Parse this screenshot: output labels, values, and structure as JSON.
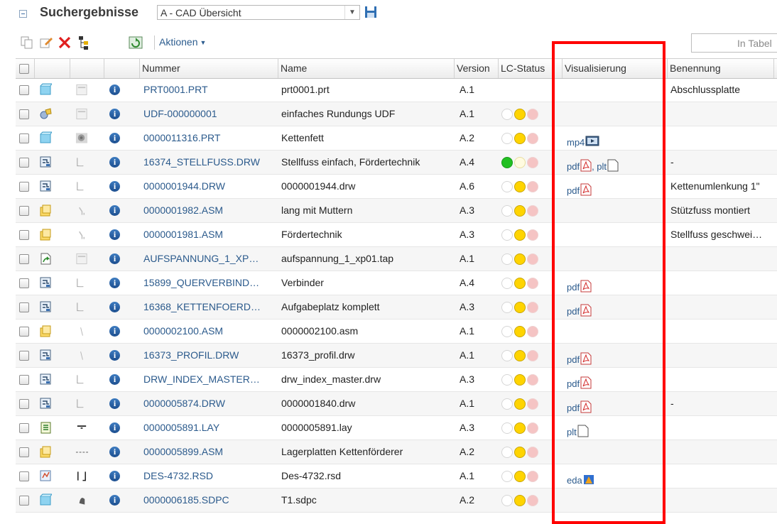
{
  "header": {
    "title": "Suchergebnisse",
    "view_select_value": "A - CAD Übersicht"
  },
  "toolbar": {
    "actions_label": "Aktionen",
    "table_search_placeholder": "In Tabel"
  },
  "columns": {
    "number": "Nummer",
    "name": "Name",
    "version": "Version",
    "lc_status": "LC-Status",
    "visualization": "Visualisierung",
    "designation": "Benennung"
  },
  "colors": {
    "link": "#2b5a8c",
    "traffic_green": "#22c022",
    "traffic_yellow": "#ffd400",
    "traffic_red_dim": "#f5c4c4",
    "highlight_box": "#ff0000"
  },
  "rows": [
    {
      "type_icon": "part-icon",
      "thumb": "document-thumb-icon",
      "number": "PRT0001.PRT",
      "name": "prt0001.prt",
      "version": "A.1",
      "lc": "none",
      "vis": [],
      "designation": "Abschlussplatte"
    },
    {
      "type_icon": "udf-icon",
      "thumb": "document-thumb-icon",
      "number": "UDF-000000001",
      "name": "einfaches Rundungs UDF",
      "version": "A.1",
      "lc": "yellow",
      "vis": [],
      "designation": ""
    },
    {
      "type_icon": "part-icon",
      "thumb": "photo-thumb-icon",
      "number": "0000011316.PRT",
      "name": "Kettenfett",
      "version": "A.2",
      "lc": "yellow",
      "vis": [
        {
          "label": "mp4",
          "icon": "video-icon"
        }
      ],
      "designation": ""
    },
    {
      "type_icon": "drawing-icon",
      "thumb": "drawing-thumb-icon",
      "number": "16374_STELLFUSS.DRW",
      "name": "Stellfuss einfach, Fördertechnik",
      "version": "A.4",
      "lc": "green",
      "vis": [
        {
          "label": "pdf",
          "icon": "pdf-icon"
        },
        {
          "label": ", plt",
          "icon": "blank-page-icon"
        }
      ],
      "designation": "-"
    },
    {
      "type_icon": "drawing-icon",
      "thumb": "drawing-thumb-icon",
      "number": "0000001944.DRW",
      "name": "0000001944.drw",
      "version": "A.6",
      "lc": "yellow",
      "vis": [
        {
          "label": "pdf",
          "icon": "pdf-icon"
        }
      ],
      "designation": "Kettenumlenkung 1\""
    },
    {
      "type_icon": "assembly-icon",
      "thumb": "bracket-thumb-icon",
      "number": "0000001982.ASM",
      "name": "lang mit Muttern",
      "version": "A.3",
      "lc": "yellow",
      "vis": [],
      "designation": "Stützfuss montiert"
    },
    {
      "type_icon": "assembly-icon",
      "thumb": "bracket-thumb-icon",
      "number": "0000001981.ASM",
      "name": "Fördertechnik",
      "version": "A.3",
      "lc": "yellow",
      "vis": [],
      "designation": "Stellfuss geschwei…"
    },
    {
      "type_icon": "nc-icon",
      "thumb": "document-thumb-icon",
      "number": "AUFSPANNUNG_1_XP…",
      "name": "aufspannung_1_xp01.tap",
      "version": "A.1",
      "lc": "yellow",
      "vis": [],
      "designation": ""
    },
    {
      "type_icon": "drawing-icon",
      "thumb": "drawing-thumb-icon",
      "number": "15899_QUERVERBIND…",
      "name": "Verbinder",
      "version": "A.4",
      "lc": "yellow",
      "vis": [
        {
          "label": "pdf",
          "icon": "pdf-icon"
        }
      ],
      "designation": ""
    },
    {
      "type_icon": "drawing-icon",
      "thumb": "drawing-thumb-icon",
      "number": "16368_KETTENFOERD…",
      "name": "Aufgabeplatz komplett",
      "version": "A.3",
      "lc": "yellow",
      "vis": [
        {
          "label": "pdf",
          "icon": "pdf-icon"
        }
      ],
      "designation": ""
    },
    {
      "type_icon": "assembly-icon",
      "thumb": "line-thumb-icon",
      "number": "0000002100.ASM",
      "name": "0000002100.asm",
      "version": "A.1",
      "lc": "yellow",
      "vis": [],
      "designation": ""
    },
    {
      "type_icon": "drawing-icon",
      "thumb": "line-thumb-icon",
      "number": "16373_PROFIL.DRW",
      "name": "16373_profil.drw",
      "version": "A.1",
      "lc": "yellow",
      "vis": [
        {
          "label": "pdf",
          "icon": "pdf-icon"
        }
      ],
      "designation": ""
    },
    {
      "type_icon": "drawing-icon",
      "thumb": "drawing-thumb-icon",
      "number": "DRW_INDEX_MASTER…",
      "name": "drw_index_master.drw",
      "version": "A.3",
      "lc": "yellow",
      "vis": [
        {
          "label": "pdf",
          "icon": "pdf-icon"
        }
      ],
      "designation": ""
    },
    {
      "type_icon": "drawing-icon",
      "thumb": "drawing-thumb-icon",
      "number": "0000005874.DRW",
      "name": "0000001840.drw",
      "version": "A.1",
      "lc": "yellow",
      "vis": [
        {
          "label": "pdf",
          "icon": "pdf-icon"
        }
      ],
      "designation": "-"
    },
    {
      "type_icon": "layout-icon",
      "thumb": "layout-thumb-icon",
      "number": "0000005891.LAY",
      "name": "0000005891.lay",
      "version": "A.3",
      "lc": "yellow",
      "vis": [
        {
          "label": "plt",
          "icon": "blank-page-icon"
        }
      ],
      "designation": ""
    },
    {
      "type_icon": "assembly-icon",
      "thumb": "dashed-thumb-icon",
      "number": "0000005899.ASM",
      "name": "Lagerplatten Kettenförderer",
      "version": "A.2",
      "lc": "yellow",
      "vis": [],
      "designation": ""
    },
    {
      "type_icon": "schematic-icon",
      "thumb": "bracket-pair-thumb-icon",
      "number": "DES-4732.RSD",
      "name": "Des-4732.rsd",
      "version": "A.1",
      "lc": "yellow",
      "vis": [
        {
          "label": "eda",
          "icon": "eda-icon"
        }
      ],
      "designation": ""
    },
    {
      "type_icon": "part-icon",
      "thumb": "shape-thumb-icon",
      "number": "0000006185.SDPC",
      "name": "T1.sdpc",
      "version": "A.2",
      "lc": "yellow",
      "vis": [],
      "designation": ""
    }
  ]
}
